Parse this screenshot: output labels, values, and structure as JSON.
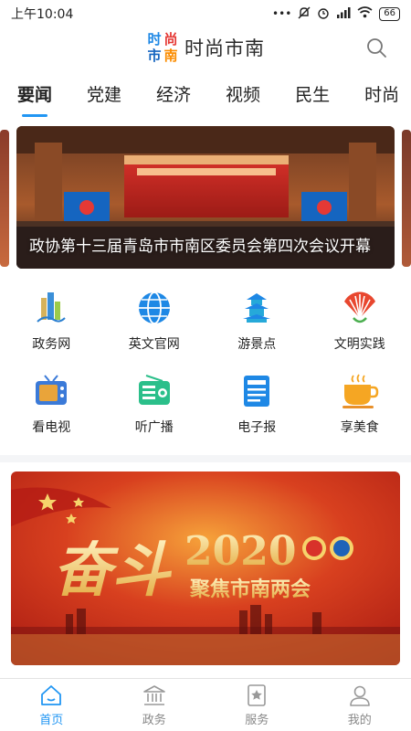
{
  "status_bar": {
    "time": "上午10:04",
    "battery": "66"
  },
  "header": {
    "logo_chars": [
      "时",
      "尚",
      "市",
      "南"
    ],
    "title": "时尚市南"
  },
  "tabs": [
    {
      "label": "要闻",
      "active": true
    },
    {
      "label": "党建",
      "active": false
    },
    {
      "label": "经济",
      "active": false
    },
    {
      "label": "视频",
      "active": false
    },
    {
      "label": "民生",
      "active": false
    },
    {
      "label": "时尚",
      "active": false
    }
  ],
  "news_banner": {
    "caption": "政协第十三届青岛市市南区委员会第四次会议开幕"
  },
  "quick_links": [
    {
      "label": "政务网",
      "icon": "government-building-icon"
    },
    {
      "label": "英文官网",
      "icon": "globe-icon"
    },
    {
      "label": "游景点",
      "icon": "pagoda-icon"
    },
    {
      "label": "文明实践",
      "icon": "fan-emblem-icon"
    },
    {
      "label": "看电视",
      "icon": "tv-icon"
    },
    {
      "label": "听广播",
      "icon": "radio-icon"
    },
    {
      "label": "电子报",
      "icon": "newspaper-icon"
    },
    {
      "label": "享美食",
      "icon": "coffee-cup-icon"
    }
  ],
  "promo": {
    "title_left": "奋斗",
    "year": "2020",
    "subtitle": "聚焦市南两会"
  },
  "bottom_nav": [
    {
      "label": "首页",
      "icon": "home-icon",
      "active": true
    },
    {
      "label": "政务",
      "icon": "government-icon",
      "active": false
    },
    {
      "label": "服务",
      "icon": "service-bookmark-icon",
      "active": false
    },
    {
      "label": "我的",
      "icon": "user-icon",
      "active": false
    }
  ],
  "colors": {
    "accent": "#2196f3",
    "promo_red": "#c62a1d",
    "promo_gold": "#f6d36b"
  }
}
